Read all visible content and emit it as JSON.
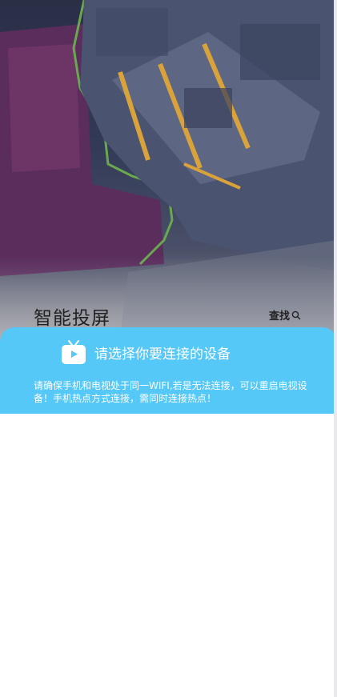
{
  "header": {
    "title": "智能投屏",
    "search_label": "查找"
  },
  "banner": {
    "headline": "请选择你要连接的设备",
    "description": "请确保手机和电视处于同一WIFI,若是无法连接，可以重启电视设备！手机热点方式连接，需同时连接热点！"
  },
  "icons": {
    "search": "search-icon",
    "tv": "tv-icon"
  },
  "colors": {
    "accent": "#56c8f7",
    "title_text": "#222222"
  }
}
